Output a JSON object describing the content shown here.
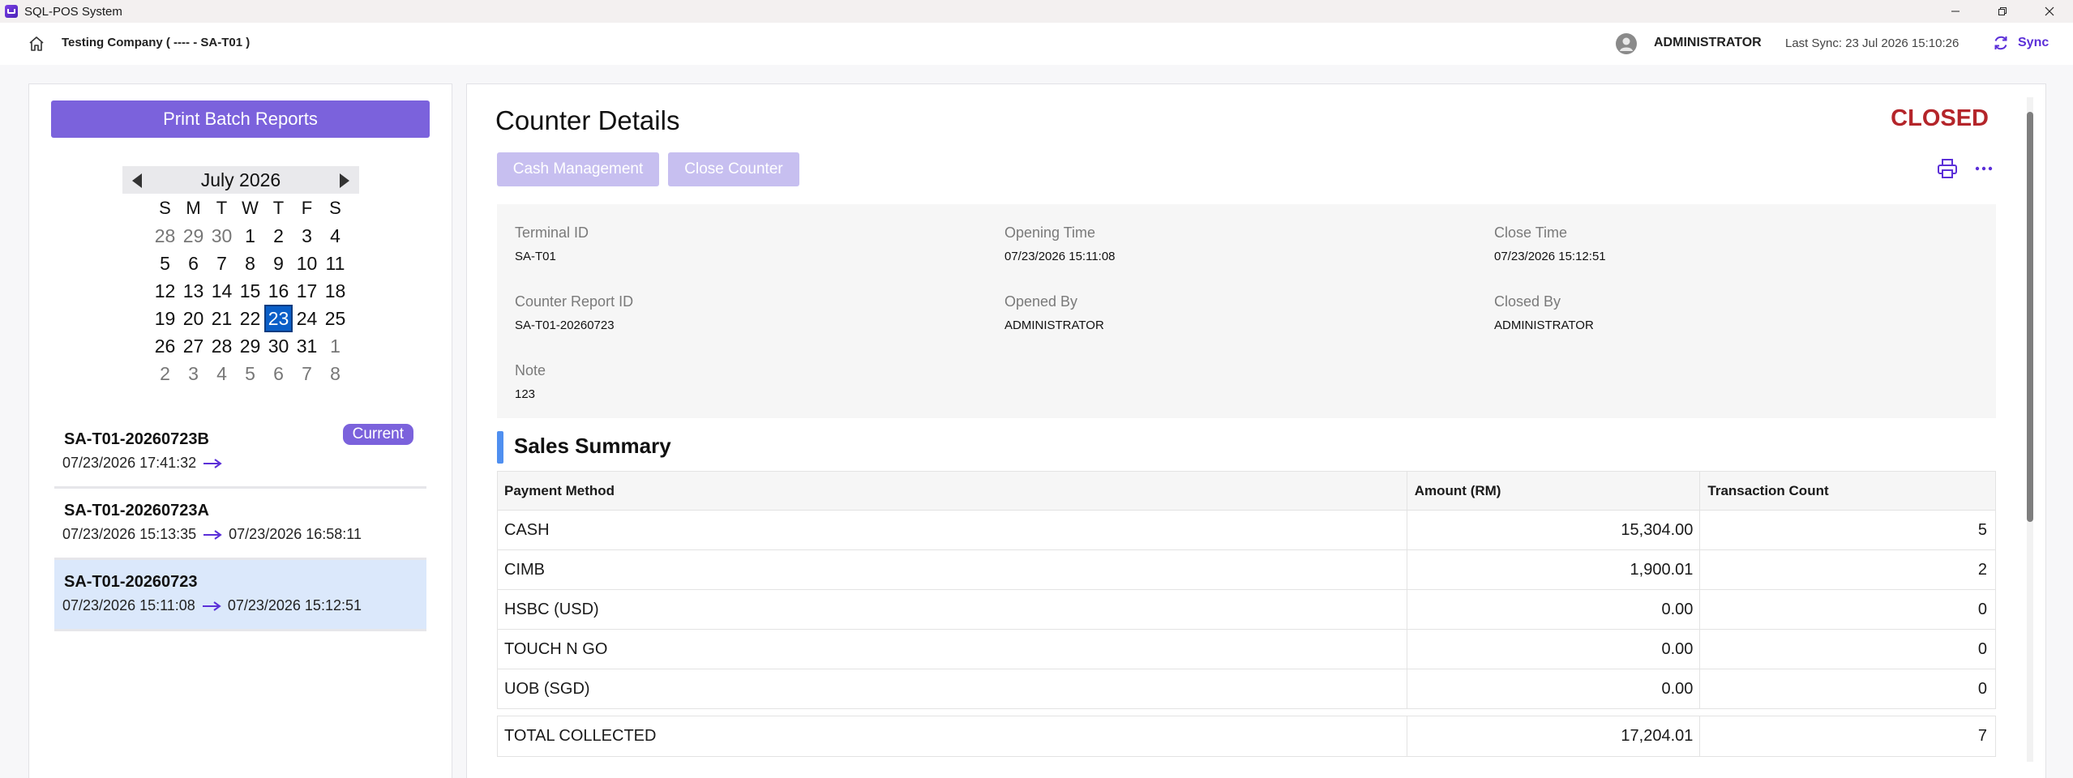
{
  "window": {
    "app_title": "SQL-POS System"
  },
  "header": {
    "company": "Testing Company ( ---- - SA-T01 )",
    "user_name": "ADMINISTRATOR",
    "last_sync": "Last Sync: 23 Jul 2026 15:10:26",
    "sync_label": "Sync"
  },
  "left": {
    "print_batch_label": "Print Batch Reports",
    "calendar": {
      "title": "July 2026",
      "weekdays": [
        "S",
        "M",
        "T",
        "W",
        "T",
        "F",
        "S"
      ],
      "weeks": [
        [
          "28",
          "29",
          "30",
          "1",
          "2",
          "3",
          "4"
        ],
        [
          "5",
          "6",
          "7",
          "8",
          "9",
          "10",
          "11"
        ],
        [
          "12",
          "13",
          "14",
          "15",
          "16",
          "17",
          "18"
        ],
        [
          "19",
          "20",
          "21",
          "22",
          "23",
          "24",
          "25"
        ],
        [
          "26",
          "27",
          "28",
          "29",
          "30",
          "31",
          "1"
        ],
        [
          "2",
          "3",
          "4",
          "5",
          "6",
          "7",
          "8"
        ]
      ],
      "selected_day": "23"
    },
    "batches": [
      {
        "id": "SA-T01-20260723B",
        "start": "07/23/2026 17:41:32",
        "end": "",
        "badge": "Current"
      },
      {
        "id": "SA-T01-20260723A",
        "start": "07/23/2026 15:13:35",
        "end": "07/23/2026 16:58:11",
        "badge": ""
      },
      {
        "id": "SA-T01-20260723",
        "start": "07/23/2026 15:11:08",
        "end": "07/23/2026 15:12:51",
        "badge": ""
      }
    ]
  },
  "main": {
    "title": "Counter Details",
    "status": "CLOSED",
    "status_color": "#b4252a",
    "cash_management_label": "Cash Management",
    "close_counter_label": "Close Counter",
    "details": {
      "terminal_id_label": "Terminal ID",
      "terminal_id": "SA-T01",
      "opening_time_label": "Opening Time",
      "opening_time": "07/23/2026 15:11:08",
      "close_time_label": "Close Time",
      "close_time": "07/23/2026 15:12:51",
      "counter_report_id_label": "Counter Report ID",
      "counter_report_id": "SA-T01-20260723",
      "opened_by_label": "Opened By",
      "opened_by": "ADMINISTRATOR",
      "closed_by_label": "Closed By",
      "closed_by": "ADMINISTRATOR",
      "note_label": "Note",
      "note": "123"
    },
    "sales_summary": {
      "title": "Sales Summary",
      "columns": [
        "Payment Method",
        "Amount (RM)",
        "Transaction Count"
      ],
      "rows": [
        {
          "method": "CASH",
          "amount": "15,304.00",
          "count": "5"
        },
        {
          "method": "CIMB",
          "amount": "1,900.01",
          "count": "2"
        },
        {
          "method": "HSBC (USD)",
          "amount": "0.00",
          "count": "0"
        },
        {
          "method": "TOUCH N GO",
          "amount": "0.00",
          "count": "0"
        },
        {
          "method": "UOB (SGD)",
          "amount": "0.00",
          "count": "0"
        }
      ],
      "total": {
        "method": "TOTAL COLLECTED",
        "amount": "17,204.01",
        "count": "7"
      }
    }
  },
  "colors": {
    "accent": "#7b62dc",
    "accent_disabled": "#c7bff0",
    "sync": "#5b2fd8",
    "selected_row": "#dbe8fb",
    "calendar_selected": "#0a5fc8",
    "section_bar": "#4f8ff0"
  }
}
